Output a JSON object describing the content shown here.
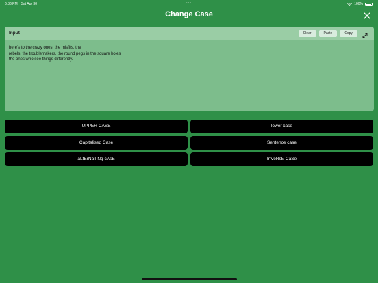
{
  "status_bar": {
    "time": "6:36 PM",
    "date": "Sat Apr 30",
    "center_indicator": "•••",
    "battery": "100%"
  },
  "header": {
    "title": "Change Case",
    "close_icon": "close-icon"
  },
  "input_panel": {
    "label": "Input",
    "buttons": {
      "clear": "Clear",
      "paste": "Paste",
      "copy": "Copy"
    },
    "expand_icon": "expand-icon",
    "text_lines": [
      "here's to the crazy ones, the misfits, the",
      "rebels, the troublemakers, the round pegs in the square holes",
      "the ones who see things differently."
    ]
  },
  "actions": [
    "UPPER CASE",
    "lower case",
    "Capitalised Case",
    "Sentence case",
    "aLtErNaTiNg cAsE",
    "InVeRsE CaSe"
  ],
  "colors": {
    "background": "#2f9048",
    "panel": "#7dbd8c",
    "panel_header": "#9acda5",
    "button": "#000000"
  }
}
